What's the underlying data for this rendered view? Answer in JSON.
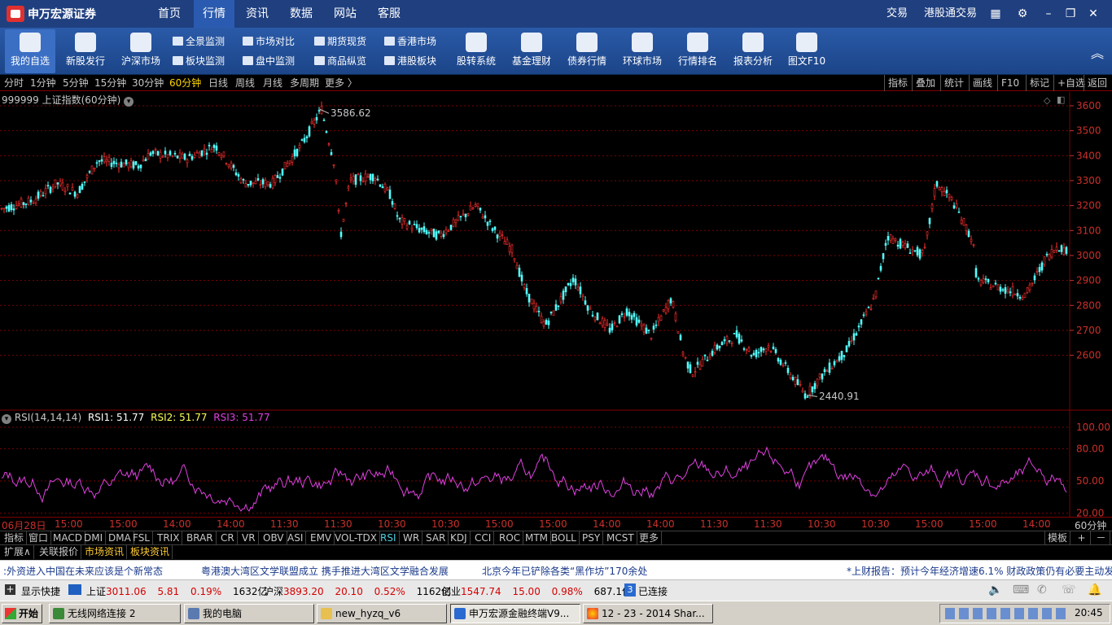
{
  "top_nav": {
    "logo": "申万宏源证券",
    "items": [
      "首页",
      "行情",
      "资讯",
      "数据",
      "网站",
      "客服"
    ],
    "active": "行情",
    "right": [
      "交易",
      "港股通交易"
    ]
  },
  "toolbar": {
    "big": [
      "我的自选",
      "新股发行",
      "沪深市场",
      "股转系统",
      "基金理财",
      "债券行情",
      "环球市场",
      "行情排名",
      "报表分析",
      "图文F10"
    ],
    "small": [
      "全景监测",
      "市场对比",
      "期货现货",
      "香港市场",
      "板块监测",
      "盘中监测",
      "商品纵览",
      "港股板块"
    ]
  },
  "period_bar": {
    "items": [
      "分时",
      "1分钟",
      "5分钟",
      "15分钟",
      "30分钟",
      "60分钟",
      "日线",
      "周线",
      "月线",
      "多周期",
      "更多 〉"
    ],
    "selected": "60分钟",
    "right": [
      "指标",
      "叠加",
      "统计",
      "画线",
      "F10",
      "标记",
      "+自选",
      "返回"
    ]
  },
  "main_chart": {
    "title": "999999 上证指数(60分钟)",
    "high_label": "3586.62",
    "low_label": "2440.91",
    "y_ticks": [
      "3600",
      "3500",
      "3400",
      "3300",
      "3200",
      "3100",
      "3000",
      "2900",
      "2800",
      "2700",
      "2600"
    ]
  },
  "rsi_chart": {
    "title": "RSI(14,14,14)",
    "rsi1": "RSI1: 51.77",
    "rsi2": "RSI2: 51.77",
    "rsi3": "RSI3: 51.77",
    "y_ticks": [
      "100.00",
      "80.00",
      "50.00",
      "20.00"
    ]
  },
  "time_axis": {
    "labels": [
      "06月28日",
      "15:00",
      "15:00",
      "14:00",
      "14:00",
      "11:30",
      "11:30",
      "10:30",
      "10:30",
      "15:00",
      "15:00",
      "14:00",
      "14:00",
      "11:30",
      "11:30",
      "10:30",
      "10:30",
      "15:00",
      "15:00",
      "14:00"
    ],
    "right": "60分钟"
  },
  "indicator_tabs": {
    "items": [
      "指标",
      "窗口",
      "MACD",
      "DMI",
      "DMA",
      "FSL",
      "TRIX",
      "BRAR",
      "CR",
      "VR",
      "OBV",
      "ASI",
      "EMV",
      "VOL-TDX",
      "RSI",
      "WR",
      "SAR",
      "KDJ",
      "CCI",
      "ROC",
      "MTM",
      "BOLL",
      "PSY",
      "MCST",
      "更多"
    ],
    "selected": "RSI",
    "right": [
      "模板",
      "+",
      "－"
    ]
  },
  "ext_tabs": {
    "items": [
      "扩展∧",
      "关联报价",
      "市场资讯",
      "板块资讯"
    ]
  },
  "ticker": {
    "items": [
      ":外资进入中国在未来应该是个新常态",
      "粤港澳大湾区文学联盟成立  携手推进大湾区文学融合发展",
      "北京今年已铲除各类“黑作坊”170余处",
      "*上财报告：预计今年经济增速6.1% 财政政策仍有必要主动发"
    ]
  },
  "status_bar": {
    "shortcut": "显示快捷",
    "sh_name": "上证",
    "sh_value": "3011.06",
    "sh_change": "5.81",
    "sh_pct": "0.19%",
    "sh_amount": "1632亿",
    "sz_name": "沪深",
    "sz_value": "3893.20",
    "sz_change": "20.10",
    "sz_pct": "0.52%",
    "sz_amount": "1162亿",
    "cy_name": "创业",
    "cy_value": "1547.74",
    "cy_change": "15.00",
    "cy_pct": "0.98%",
    "cy_amount": "687.1亿",
    "conn_count": "3",
    "conn_label": "已连接"
  },
  "taskbar": {
    "start": "开始",
    "tasks": [
      "无线网络连接 2",
      "我的电脑",
      "new_hyzq_v6",
      "申万宏源金融终端V9...",
      "12 - 23 - 2014 Shar..."
    ],
    "clock": "20:45"
  },
  "colors": {
    "up": "#ff3030",
    "down": "#54ffff",
    "rsi": "#e040e0",
    "grid": "#800000",
    "accent_nav": "#1f3f7f"
  }
}
